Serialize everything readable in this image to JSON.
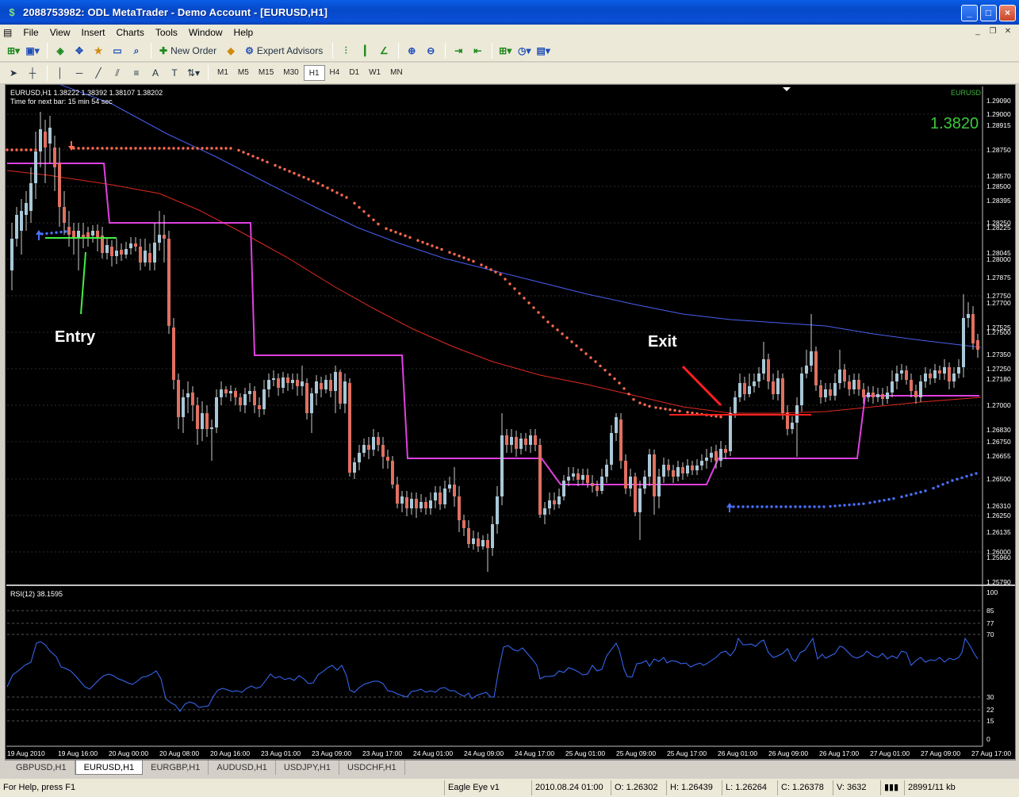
{
  "window": {
    "title": "2088753982: ODL MetaTrader - Demo Account - [EURUSD,H1]",
    "buttons": [
      "_",
      "□",
      "×"
    ]
  },
  "menu": [
    "File",
    "View",
    "Insert",
    "Charts",
    "Tools",
    "Window",
    "Help"
  ],
  "toolbar": {
    "new_order": "New Order",
    "expert_advisors": "Expert Advisors",
    "periods": [
      "M1",
      "M5",
      "M15",
      "M30",
      "H1",
      "H4",
      "D1",
      "W1",
      "MN"
    ],
    "active_period": "H1"
  },
  "chart": {
    "info_line": "EURUSD,H1  1.38222 1.38392 1.38107 1.38202",
    "timer": "Time for next bar: 15 min 54 sec",
    "symbol_label": "EURUSD",
    "big_price": "1.3820",
    "entry_label": "Entry",
    "exit_label": "Exit",
    "price_labels": [
      "1.29090",
      "1.29000",
      "1.28915",
      "1.28750",
      "1.28570",
      "1.28500",
      "1.28395",
      "1.28250",
      "1.28225",
      "1.28045",
      "1.28000",
      "1.27875",
      "1.27750",
      "1.27700",
      "1.27525",
      "1.27500",
      "1.27350",
      "1.27250",
      "1.27180",
      "1.27000",
      "1.26830",
      "1.26750",
      "1.26655",
      "1.26500",
      "1.26310",
      "1.26250",
      "1.26135",
      "1.26000",
      "1.25960",
      "1.25790"
    ],
    "time_labels": [
      "19 Aug 2010",
      "19 Aug 16:00",
      "20 Aug 00:00",
      "20 Aug 08:00",
      "20 Aug 16:00",
      "23 Aug 01:00",
      "23 Aug 09:00",
      "23 Aug 17:00",
      "24 Aug 01:00",
      "24 Aug 09:00",
      "24 Aug 17:00",
      "25 Aug 01:00",
      "25 Aug 09:00",
      "25 Aug 17:00",
      "26 Aug 01:00",
      "26 Aug 09:00",
      "26 Aug 17:00",
      "27 Aug 01:00",
      "27 Aug 09:00",
      "27 Aug 17:00"
    ],
    "rsi_label": "RSI(12) 38.1595",
    "rsi_levels": [
      "100",
      "85",
      "77",
      "70",
      "30",
      "22",
      "15",
      "0"
    ],
    "colors": {
      "background": "#000000",
      "bull": "#a8c8d8",
      "bear": "#e07060",
      "ma_blue": "#4a5ff0",
      "ma_red": "#e02a20",
      "channel": "#e040e0",
      "sar_red": "#ff6a50",
      "sar_blue": "#4a70ff",
      "rsi": "#3a6cff",
      "entry_line": "#44ee44",
      "exit_line": "#ff2020"
    }
  },
  "tabs": [
    "GBPUSD,H1",
    "EURUSD,H1",
    "EURGBP,H1",
    "AUDUSD,H1",
    "USDJPY,H1",
    "USDCHF,H1"
  ],
  "active_tab": "EURUSD,H1",
  "status": {
    "help": "For Help, press F1",
    "profile": "Eagle Eye v1",
    "datetime": "2010.08.24 01:00",
    "open": "O: 1.26302",
    "high": "H: 1.26439",
    "low": "L: 1.26264",
    "close": "C: 1.26378",
    "volume": "V: 3632",
    "traffic": "28991/11 kb"
  }
}
